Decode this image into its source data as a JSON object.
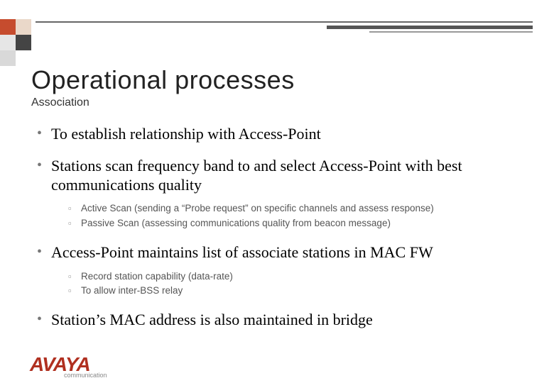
{
  "header": {
    "title": "Operational processes",
    "subtitle": "Association"
  },
  "bullets": [
    {
      "text": "To establish relationship with Access-Point",
      "sub": []
    },
    {
      "text": "Stations scan frequency band to and select Access-Point with best communications quality",
      "sub": [
        "Active Scan (sending a “Probe request” on specific channels and assess response)",
        "Passive Scan (assessing communications quality from beacon message)"
      ]
    },
    {
      "text": "Access-Point maintains list of associate stations in MAC FW",
      "sub": [
        "Record station capability (data-rate)",
        "To allow inter-BSS relay"
      ]
    },
    {
      "text": "Station’s MAC address is also maintained in bridge",
      "sub": []
    }
  ],
  "logo": {
    "word": "AVAYA",
    "sub": "communication"
  }
}
